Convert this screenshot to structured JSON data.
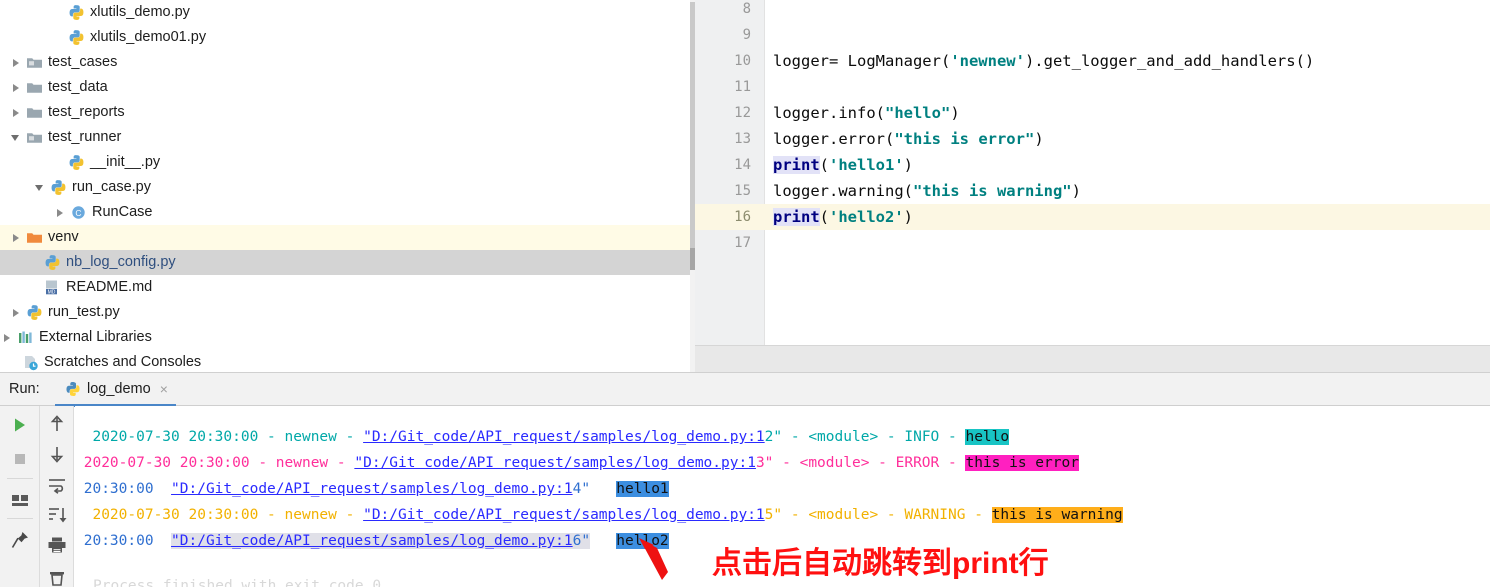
{
  "project_tree": {
    "items": [
      {
        "label": "xlutils_demo.py",
        "indent": 68,
        "arrow": "none",
        "icon": "python-file-icon"
      },
      {
        "label": "xlutils_demo01.py",
        "indent": 68,
        "arrow": "none",
        "icon": "python-file-icon"
      },
      {
        "label": "test_cases",
        "indent": 26,
        "arrow": "right",
        "icon": "folder-src-icon"
      },
      {
        "label": "test_data",
        "indent": 26,
        "arrow": "right",
        "icon": "folder-icon"
      },
      {
        "label": "test_reports",
        "indent": 26,
        "arrow": "right",
        "icon": "folder-icon"
      },
      {
        "label": "test_runner",
        "indent": 26,
        "arrow": "down",
        "icon": "folder-src-icon"
      },
      {
        "label": "__init__.py",
        "indent": 68,
        "arrow": "none",
        "icon": "python-file-icon"
      },
      {
        "label": "run_case.py",
        "indent": 50,
        "arrow": "down",
        "icon": "python-file-icon"
      },
      {
        "label": "RunCase",
        "indent": 70,
        "arrow": "right",
        "icon": "class-icon"
      },
      {
        "label": "venv",
        "indent": 26,
        "arrow": "right",
        "icon": "folder-venv-icon",
        "row_highlight": "yellow"
      },
      {
        "label": "nb_log_config.py",
        "indent": 44,
        "arrow": "none",
        "icon": "python-file-icon",
        "row_highlight": "selected"
      },
      {
        "label": "README.md",
        "indent": 44,
        "arrow": "none",
        "icon": "markdown-icon"
      },
      {
        "label": "run_test.py",
        "indent": 26,
        "arrow": "right",
        "icon": "python-file-icon"
      },
      {
        "label": "External Libraries",
        "indent": 4,
        "arrow": "right",
        "icon": "libraries-icon"
      },
      {
        "label": "Scratches and Consoles",
        "indent": 22,
        "arrow": "none",
        "icon": "scratches-icon"
      }
    ]
  },
  "editor": {
    "line_numbers": [
      "8",
      "9",
      "10",
      "11",
      "12",
      "13",
      "14",
      "15",
      "16",
      "17"
    ],
    "current_line": "16",
    "lines": [
      {
        "num": "8",
        "segments": []
      },
      {
        "num": "9",
        "segments": []
      },
      {
        "num": "10",
        "segments": [
          {
            "t": "logger= LogManager(",
            "c": "plain"
          },
          {
            "t": "'newnew'",
            "c": "string"
          },
          {
            "t": ").get_logger_and_add_handlers()",
            "c": "plain"
          }
        ]
      },
      {
        "num": "11",
        "segments": []
      },
      {
        "num": "12",
        "segments": [
          {
            "t": "logger.info(",
            "c": "plain"
          },
          {
            "t": "\"hello\"",
            "c": "string"
          },
          {
            "t": ")",
            "c": "plain"
          }
        ]
      },
      {
        "num": "13",
        "segments": [
          {
            "t": "logger.error(",
            "c": "plain"
          },
          {
            "t": "\"this is error\"",
            "c": "string"
          },
          {
            "t": ")",
            "c": "plain"
          }
        ]
      },
      {
        "num": "14",
        "segments": [
          {
            "t": "print",
            "c": "keyword"
          },
          {
            "t": "(",
            "c": "plain"
          },
          {
            "t": "'hello1'",
            "c": "string"
          },
          {
            "t": ")",
            "c": "plain"
          }
        ]
      },
      {
        "num": "15",
        "segments": [
          {
            "t": "logger.warning(",
            "c": "plain"
          },
          {
            "t": "\"this is warning\"",
            "c": "string"
          },
          {
            "t": ")",
            "c": "plain"
          }
        ]
      },
      {
        "num": "16",
        "segments": [
          {
            "t": "print",
            "c": "keyword"
          },
          {
            "t": "(",
            "c": "plain"
          },
          {
            "t": "'hello2'",
            "c": "string"
          },
          {
            "t": ")",
            "c": "plain"
          }
        ]
      },
      {
        "num": "17",
        "segments": []
      }
    ]
  },
  "run_panel": {
    "run_label": "Run:",
    "tab_name": "log_demo",
    "tab_close": "×",
    "toolbar_left": [
      {
        "name": "rerun-button",
        "glyph": "play"
      },
      {
        "name": "stop-button",
        "glyph": "stop"
      },
      {
        "name": "layout-button",
        "glyph": "layout"
      },
      {
        "name": "pin-tab-button",
        "glyph": "pin"
      }
    ],
    "toolbar_right": [
      {
        "name": "up-the-stack-trace-button",
        "glyph": "arrow-up"
      },
      {
        "name": "down-the-stack-trace-button",
        "glyph": "arrow-down"
      },
      {
        "name": "soft-wrap-button",
        "glyph": "soft-wrap"
      },
      {
        "name": "scroll-to-end-button",
        "glyph": "scroll-end"
      },
      {
        "name": "print-button",
        "glyph": "printer"
      },
      {
        "name": "clear-all-button",
        "glyph": "trash"
      }
    ],
    "console_lines": [
      {
        "level": "INFO",
        "timestamp": "2020-07-30 20:30:00",
        "logger_name": "newnew",
        "link": "\"D:/Git_code/API_request/samples/log_demo.py:1",
        "link_tail": "2\"",
        "module": "<module>",
        "level_text": "INFO",
        "message": "hello",
        "prefix": "  2020-07-30 20:30:00 - newnew - ",
        "after_link": " - <module> - INFO - "
      },
      {
        "level": "ERROR",
        "timestamp": "2020-07-30 20:30:00",
        "logger_name": "newnew",
        "link": "\"D:/Git code/API request/samples/log demo.py:1",
        "link_tail": "3\"",
        "module": "<module>",
        "level_text": "ERROR",
        "message": "this is error",
        "prefix": " 2020-07-30 20:30:00 - newnew - ",
        "after_link": " - <module> - ERROR - "
      },
      {
        "level": "PRINT",
        "timestamp": "20:30:00",
        "link": "\"D:/Git_code/API_request/samples/log_demo.py:1",
        "link_tail": "4\"",
        "message": "hello1",
        "prefix": " 20:30:00  ",
        "after_link": "   "
      },
      {
        "level": "WARNING",
        "timestamp": "2020-07-30 20:30:00",
        "logger_name": "newnew",
        "link": "\"D:/Git_code/API_request/samples/log_demo.py:1",
        "link_tail": "5\"",
        "module": "<module>",
        "level_text": "WARNING",
        "message": "this is warning",
        "prefix": "  2020-07-30 20:30:00 - newnew - ",
        "after_link": " - <module> - WARNING - "
      },
      {
        "level": "PRINT",
        "timestamp": "20:30:00",
        "link": "\"D:/Git_code/API_request/samples/log_demo.py:1",
        "link_tail": "6\"",
        "message": "hello2",
        "prefix": " 20:30:00  ",
        "after_link": "   ",
        "link_hovered": true
      }
    ],
    "process_finished": "Process finished with exit code 0"
  },
  "annotation": {
    "text": "点击后自动跳转到print行",
    "color": "#ff1010"
  },
  "colors": {
    "info_highlight": "#18c4c4",
    "error_highlight": "#ff20c0",
    "warning_highlight": "#ffae1a",
    "print_highlight": "#3c8ee0",
    "link": "#2a2aff",
    "current_line": "#fcf7e3",
    "selection": "#d4d4d4"
  }
}
